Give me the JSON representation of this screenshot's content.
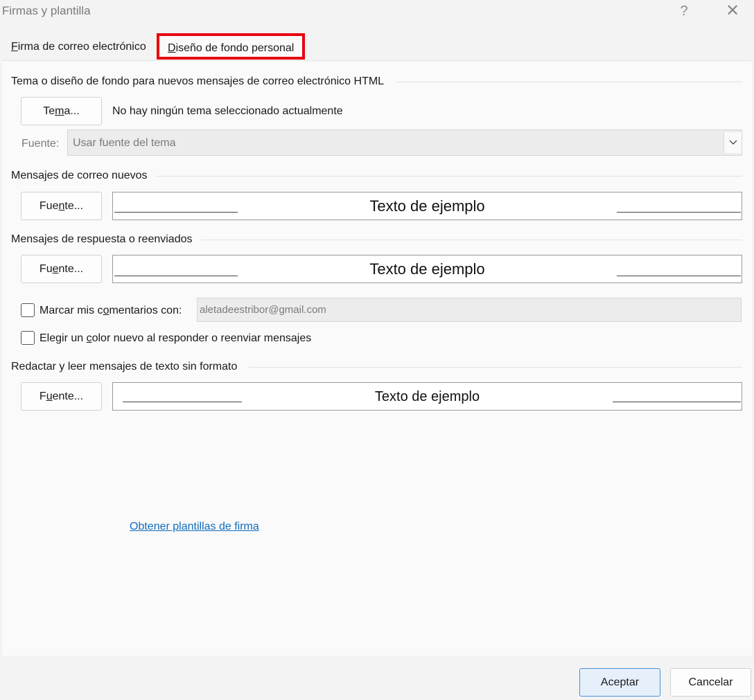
{
  "window": {
    "title": "Firmas y plantilla",
    "help": "?",
    "close": "✕"
  },
  "tabs": [
    {
      "pre": "",
      "key": "F",
      "post": "irma de correo electrónico"
    },
    {
      "pre": "",
      "key": "D",
      "post": "iseño de fondo personal"
    }
  ],
  "theme": {
    "section_title": "Tema o diseño de fondo para nuevos mensajes de correo electrónico HTML",
    "button": {
      "pre": "Te",
      "key": "m",
      "post": "a..."
    },
    "status": "No hay ningún tema seleccionado actualmente",
    "font_label": "Fuente:",
    "font_value": "Usar fuente del tema"
  },
  "new_mail": {
    "section_title": "Mensajes de correo nuevos",
    "button": {
      "pre": "Fue",
      "key": "n",
      "post": "te..."
    },
    "sample": "Texto de ejemplo"
  },
  "reply": {
    "section_title": "Mensajes de respuesta o reenviados",
    "button": {
      "pre": "Fu",
      "key": "e",
      "post": "nte..."
    },
    "sample": "Texto de ejemplo",
    "mark_comments": {
      "pre": "Marcar mis c",
      "key": "o",
      "post": "mentarios con:",
      "checked": false
    },
    "mark_value": "aletadeestribor@gmail.com",
    "new_color": {
      "pre": "Elegir un ",
      "key": "c",
      "post": "olor nuevo al responder o reenviar mensajes",
      "checked": false
    }
  },
  "plain_text": {
    "section_title": "Redactar y leer mensajes de texto sin formato",
    "button": {
      "pre": "F",
      "key": "u",
      "post": "ente..."
    },
    "sample": "Texto de ejemplo"
  },
  "link": "Obtener plantillas de firma",
  "footer": {
    "ok": "Aceptar",
    "cancel": "Cancelar"
  },
  "colors": {
    "highlight_border": "#e8000e",
    "link": "#0f6cbd",
    "ok_border": "#4a8fd6"
  }
}
